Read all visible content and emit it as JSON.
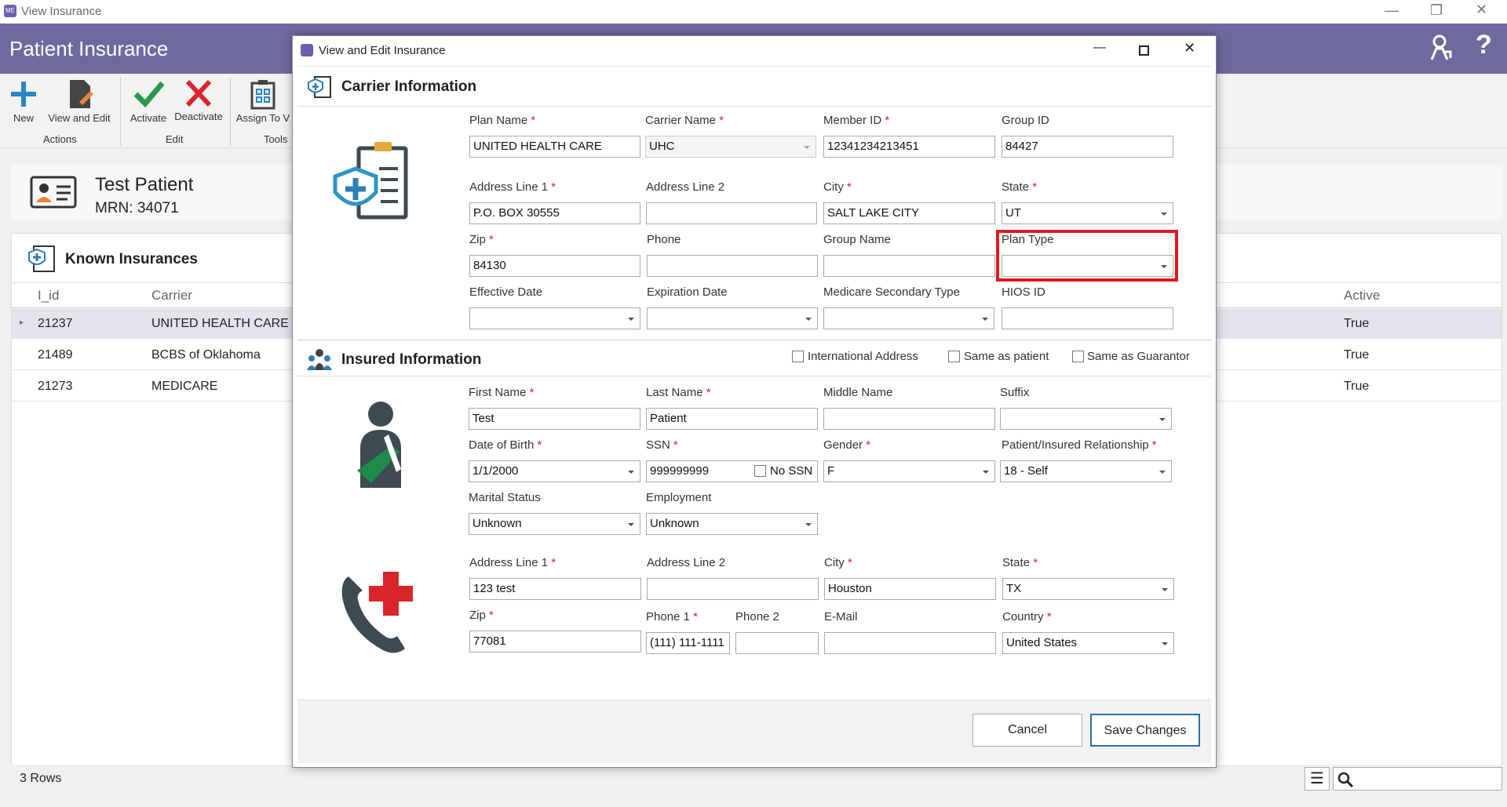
{
  "window": {
    "title": "View Insurance",
    "app_icon": "app-logo"
  },
  "app": {
    "title": "Patient Insurance"
  },
  "toolbar": {
    "new_label": "New",
    "view_edit_label": "View and Edit",
    "group_actions": "Actions",
    "activate_label": "Activate",
    "deactivate_label": "Deactivate",
    "group_edit": "Edit",
    "assign_label": "Assign To V",
    "group_tools": "Tools"
  },
  "patient": {
    "name": "Test Patient",
    "mrn": "MRN: 34071"
  },
  "known": {
    "title": "Known Insurances",
    "columns": [
      "I_id",
      "Carrier",
      "Active"
    ],
    "rows": [
      {
        "id": "21237",
        "carrier": "UNITED HEALTH CARE",
        "active": "True"
      },
      {
        "id": "21489",
        "carrier": "BCBS of Oklahoma",
        "active": "True"
      },
      {
        "id": "21273",
        "carrier": "MEDICARE",
        "active": "True"
      }
    ],
    "row_count": "3 Rows"
  },
  "dialog": {
    "title": "View and Edit Insurance",
    "carrier_section": "Carrier Information",
    "insured_section": "Insured Information",
    "cancel": "Cancel",
    "save": "Save Changes",
    "checks": {
      "intl": "International Address",
      "same_patient": "Same as patient",
      "same_guarantor": "Same as Guarantor",
      "no_ssn": "No SSN"
    }
  },
  "carrier": {
    "plan_name": {
      "label": "Plan Name",
      "value": "UNITED HEALTH CARE"
    },
    "carrier_name": {
      "label": "Carrier Name",
      "value": "UHC"
    },
    "member_id": {
      "label": "Member ID",
      "value": "12341234213451"
    },
    "group_id": {
      "label": "Group ID",
      "value": "84427"
    },
    "addr1": {
      "label": "Address Line 1",
      "value": "P.O. BOX 30555"
    },
    "addr2": {
      "label": "Address Line 2",
      "value": ""
    },
    "city": {
      "label": "City",
      "value": "SALT LAKE CITY"
    },
    "state": {
      "label": "State",
      "value": "UT"
    },
    "zip": {
      "label": "Zip",
      "value": "84130"
    },
    "phone": {
      "label": "Phone",
      "value": ""
    },
    "group_name": {
      "label": "Group Name",
      "value": ""
    },
    "plan_type": {
      "label": "Plan Type",
      "value": ""
    },
    "eff_date": {
      "label": "Effective Date",
      "value": ""
    },
    "exp_date": {
      "label": "Expiration Date",
      "value": ""
    },
    "med_sec": {
      "label": "Medicare Secondary Type",
      "value": ""
    },
    "hios": {
      "label": "HIOS ID",
      "value": ""
    }
  },
  "insured": {
    "first": {
      "label": "First Name",
      "value": "Test"
    },
    "last": {
      "label": "Last Name",
      "value": "Patient"
    },
    "middle": {
      "label": "Middle Name",
      "value": ""
    },
    "suffix": {
      "label": "Suffix",
      "value": ""
    },
    "dob": {
      "label": "Date of Birth",
      "value": "1/1/2000"
    },
    "ssn": {
      "label": "SSN",
      "value": "999999999"
    },
    "gender": {
      "label": "Gender",
      "value": "F"
    },
    "relationship": {
      "label": "Patient/Insured Relationship",
      "value": "18 - Self"
    },
    "marital": {
      "label": "Marital Status",
      "value": "Unknown"
    },
    "employment": {
      "label": "Employment",
      "value": "Unknown"
    },
    "addr1": {
      "label": "Address Line 1",
      "value": "123 test"
    },
    "addr2": {
      "label": "Address Line 2",
      "value": ""
    },
    "city": {
      "label": "City",
      "value": "Houston"
    },
    "state": {
      "label": "State",
      "value": "TX"
    },
    "zip": {
      "label": "Zip",
      "value": "77081"
    },
    "phone1": {
      "label": "Phone 1",
      "value": "(111) 111-1111"
    },
    "phone2": {
      "label": "Phone 2",
      "value": ""
    },
    "email": {
      "label": "E-Mail",
      "value": ""
    },
    "country": {
      "label": "Country",
      "value": "United States"
    }
  },
  "colors": {
    "header": "#6e6aa0",
    "highlight": "#e0191e",
    "accent": "#2c7fb8"
  }
}
